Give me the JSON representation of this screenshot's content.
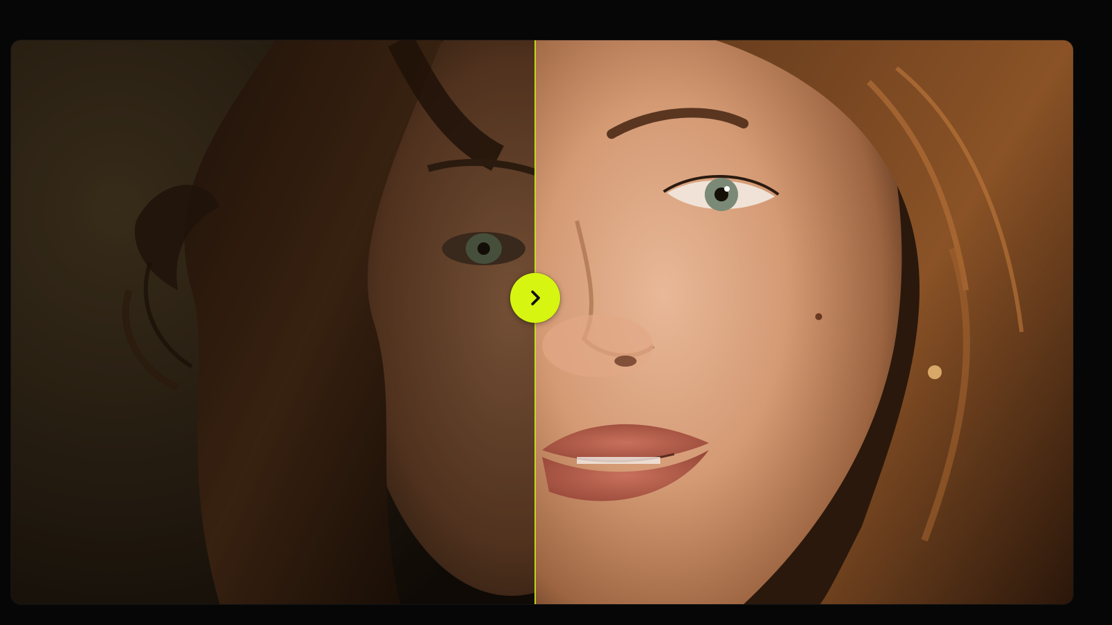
{
  "comparison": {
    "mode": "before-after",
    "split_position": 0.49,
    "handle_icon": "chevron-right-icon",
    "accent_color": "#d6f511",
    "divider_color": "#c8e61c",
    "before_image": "portrait-original-dim",
    "after_image": "portrait-enhanced-bright"
  },
  "colors": {
    "page_background": "#060606",
    "frame_background": "#1a130c"
  }
}
